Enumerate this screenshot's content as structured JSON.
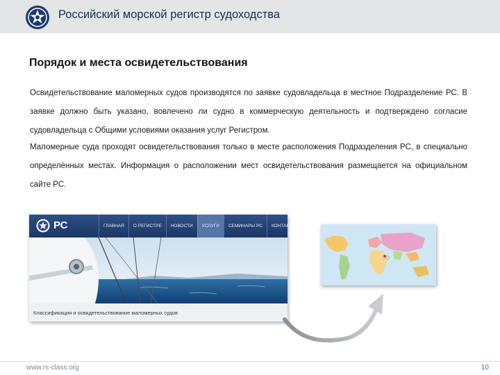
{
  "header": {
    "org_title": "Российский морской регистр судоходства",
    "logo_icon": "rs-emblem-icon"
  },
  "slide": {
    "title": "Порядок и места освидетельствования",
    "paragraphs": [
      "Освидетельствование маломерных судов производятся по заявке судовладельца в местное Подразделение РС. В заявке должно быть указано, вовлечено ли судно в коммерческую деятельность и подтверждено согласие судовладельца с Общими условиями оказания услуг Регистром.",
      "Маломерные суда проходят освидетельствования только в месте расположения Подразделения РС, в специально определённых местах. Информация о расположении мест освидетельствования размещается на официальном сайте РС."
    ]
  },
  "website": {
    "logo_text": "РС",
    "menu": [
      "ГЛАВНАЯ",
      "О РЕГИСТРЕ",
      "НОВОСТИ",
      "УСЛУГИ",
      "СЕМИНАРЫ РС",
      "КОНТАКТЫ"
    ],
    "active_menu_index": 3,
    "caption": "Классификация и освидетельствование маломерных судов"
  },
  "footer": {
    "url": "www.rs-class.org",
    "page_number": "10"
  },
  "colors": {
    "header_bg": "#e4e5e6",
    "title_blue": "#1d2d4a",
    "site_nav": "#1b3766",
    "footer_text": "#7b8798"
  }
}
